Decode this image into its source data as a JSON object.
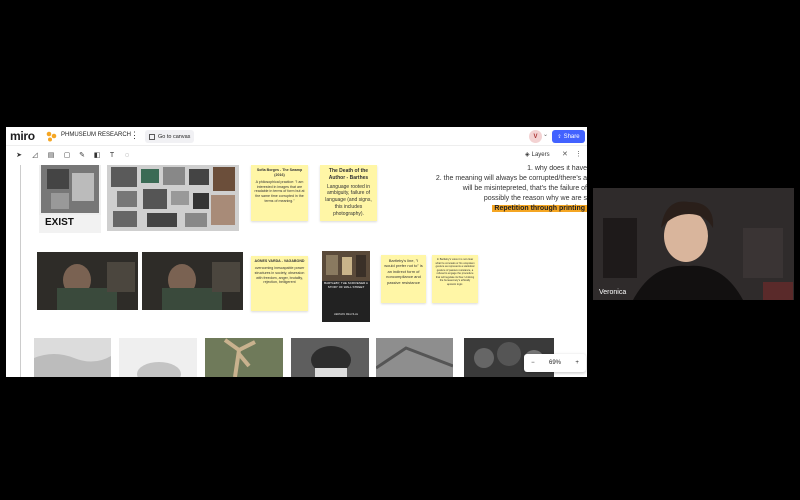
{
  "header": {
    "logo": "miro",
    "board_name": "PHMUSEUM RESEARCH",
    "more": "⋮",
    "go_to_canvas": "Go to canvas",
    "avatar_initial": "V",
    "share_label": "Share"
  },
  "toolbar": {
    "tools": [
      "select-tool",
      "pen-tool",
      "sticky-tool",
      "shape-tool",
      "connector-tool",
      "comment-tool",
      "text-tool",
      "emoji-tool"
    ],
    "layers_label": "Layers"
  },
  "board": {
    "stickies": [
      {
        "title": "Sofia Borges - The Swamp (2016)",
        "body": "A philosophical practice: \"I am interested in images that are readable in terms of form but at the same time corrupted in the terms of meaning.\""
      },
      {
        "title": "The Death of the Author - Barthes",
        "body": "Language rooted in ambiguity, failure of language (and signs, this includes photography)."
      },
      {
        "title": "AGNES VARDA - VAGABOND",
        "body": "overcoming inescapable power structures in society, obsession with freedom, anger, brutality, rejection, belligerent"
      },
      {
        "title": "",
        "body": "Bartleby's line, \"I would prefer not to\" is an indirect form of noncompliance and passive resistance"
      },
      {
        "title": "",
        "body": "In Bartleby's voice it is not clear what he conceals or his unspoken gesture as represents a statistical gesture of passive resistance, a refusal to engage the procedure that will regulate its flow. Undoing the bureaucracy's ethically aporetic logic."
      }
    ],
    "book_title": "BARTLEBY, THE SCRIVENER A STORY OF WALL STREET",
    "book_author": "HERMAN MELVILLE",
    "exist_label": "EXIST",
    "right_text": {
      "line1": "1. why does it have",
      "line2": "2. the meaning will always be corrupted/there's a",
      "line3": "will be misintepreted, that's the failure of",
      "line4": "possibly the reason why we are s",
      "highlight": "Repetition through printing"
    },
    "zoom": "69%",
    "zoom_minus": "−",
    "zoom_plus": "+"
  },
  "webcam": {
    "participant": "Veronica"
  },
  "colors": {
    "share_blue": "#4262ff",
    "sticky_yellow": "#fff6a6",
    "highlight_orange": "#f5a623"
  }
}
